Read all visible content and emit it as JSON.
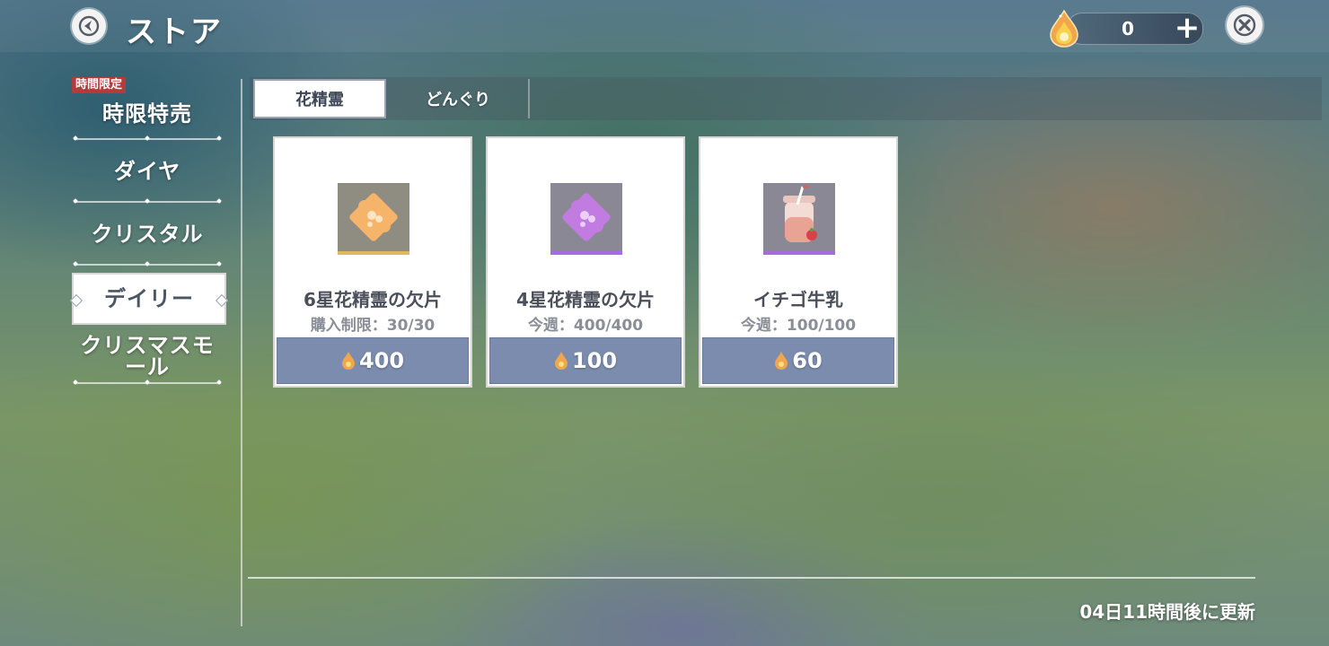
{
  "header": {
    "title": "ストア",
    "currency_value": "0"
  },
  "sidebar": {
    "items": [
      {
        "label": "時限特売",
        "badge": "時間限定"
      },
      {
        "label": "ダイヤ"
      },
      {
        "label": "クリスタル"
      },
      {
        "label": "デイリー",
        "active": true
      },
      {
        "label": "クリスマスモ\nール"
      }
    ]
  },
  "tabs": [
    {
      "label": "花精霊",
      "active": true
    },
    {
      "label": "どんぐり"
    }
  ],
  "products": [
    {
      "name": "6星花精霊の欠片",
      "limit": "購入制限：30/30",
      "price": "400",
      "icon": "orange-puzzle-piece-icon"
    },
    {
      "name": "4星花精霊の欠片",
      "limit": "今週：400/400",
      "price": "100",
      "icon": "purple-puzzle-piece-icon"
    },
    {
      "name": "イチゴ牛乳",
      "limit": "今週：100/100",
      "price": "60",
      "icon": "strawberry-milk-jar-icon"
    }
  ],
  "footer": {
    "refresh_text": "04日11時間後に更新"
  },
  "colors": {
    "price_bar": "#7b8cae",
    "badge_red": "#b53a3a",
    "tab_active_text": "#3d4756"
  }
}
